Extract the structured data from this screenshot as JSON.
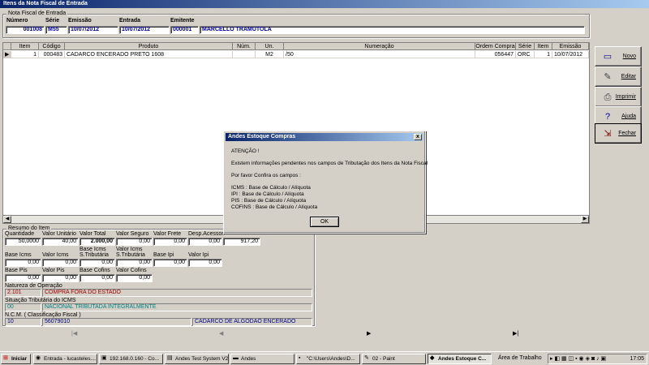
{
  "window": {
    "title": "Itens da Nota Fiscal de Entrada"
  },
  "header": {
    "group_title": "Nota Fiscal de Entrada",
    "labels": {
      "numero": "Número",
      "serie": "Série",
      "emissao": "Emissão",
      "entrada": "Entrada",
      "emitente": "Emitente"
    },
    "values": {
      "numero": "001008",
      "serie": "M55",
      "emissao": "10/07/2012",
      "entrada": "10/07/2012",
      "emitente_code": "000001",
      "emitente_name": "MARCELLO TRAMUTOLA"
    }
  },
  "grid": {
    "columns": [
      "Item",
      "Código",
      "Produto",
      "Núm.",
      "Un.",
      "Numeração",
      "Ordem Compra",
      "Série",
      "Item",
      "Emissão"
    ],
    "rows": [
      {
        "marker": "▶",
        "cells": [
          "1",
          "000483",
          "CADARCO ENCERADO PRETO 1608",
          "",
          "M2",
          "/50",
          "056447",
          "ORC",
          "1",
          "10/07/2012"
        ]
      }
    ]
  },
  "buttons": [
    {
      "label": "Novo",
      "icon": "new-document-icon",
      "glyph": "▭"
    },
    {
      "label": "Editar",
      "icon": "edit-pencil-icon",
      "glyph": "✎"
    },
    {
      "label": "Imprimir",
      "icon": "printer-icon",
      "glyph": "⎙"
    },
    {
      "label": "Ajuda",
      "icon": "help-icon",
      "glyph": "?"
    },
    {
      "label": "Fechar",
      "icon": "close-door-icon",
      "glyph": "⇲"
    }
  ],
  "summary": {
    "group_title": "Resumo do Item",
    "labels": {
      "quantidade": "Quantidade",
      "valor_unitario": "Valor Unitário",
      "valor_total": "Valor Total",
      "valor_seguro": "Valor Seguro",
      "valor_frete": "Valor Frete",
      "desp_acessor": "Desp.Acessor.",
      "base_icms": "Base Icms",
      "valor_icms": "Valor Icms",
      "base_icms_st": "Base Icms S.Tributária",
      "valor_icms_st": "Valor Icms S.Tributária",
      "base_ipi": "Base Ipi",
      "valor_ipi": "Valor Ipi",
      "base_pis": "Base Pis",
      "valor_pis": "Valor Pis",
      "base_cofins": "Base Cofins",
      "valor_cofins": "Valor Cofins",
      "natureza": "Natureza de Operação",
      "situacao": "Situação Tributária do ICMS",
      "ncm": "N.C.M. ( Classificação Fiscal )"
    },
    "values": {
      "quantidade": "50,0000",
      "valor_unitario": "40,00",
      "valor_total": "2.000,00",
      "valor_seguro": "0,00",
      "valor_frete": "0,00",
      "desp_acessor": "0,00",
      "extra_total": "917,20",
      "base_icms": "0,00",
      "valor_icms": "0,00",
      "base_icms_st": "0,00",
      "valor_icms_st": "0,00",
      "base_ipi": "0,00",
      "valor_ipi": "0,00",
      "base_pis": "0,00",
      "valor_pis": "0,00",
      "base_cofins": "0,00",
      "valor_cofins": "0,00",
      "natureza_code": "2.101",
      "natureza_desc": "COMPRA FORA DO ESTADO",
      "situacao_code": "00",
      "situacao_desc": "NACIONAL TRIBUTADA INTEGRALMENTE",
      "ncm_code": "10",
      "ncm_value": "56079010",
      "ncm_desc": "CADARCO DE ALGODAO ENCERADO"
    }
  },
  "navigator": {
    "first": "|◀",
    "prev": "◀",
    "next": "▶",
    "last": "▶|"
  },
  "dialog": {
    "title": "Andes Estoque Compras",
    "close": "x",
    "heading": "ATENÇÃO !",
    "line1": "Existem informações pendentes nos campos de Tributação dos Itens da Nota Fiscal",
    "line2": "Por favor Confira os campos :",
    "items": [
      "ICMS   : Base de Cálculo / Alíquota",
      "IPI    : Base de Cálculo / Alíquota",
      "PIS    : Base de Cálculo / Alíquota",
      "COFINS : Base de Cálculo / Alíquota"
    ],
    "ok": "OK"
  },
  "taskbar": {
    "start": "Iniciar",
    "tasks": [
      {
        "label": "Entrada - lucasteles....",
        "icon": "chrome-icon",
        "glyph": "◉"
      },
      {
        "label": "192.168.0.160 - Co...",
        "icon": "remote-desktop-icon",
        "glyph": "▣"
      },
      {
        "label": "Andes Test System V2",
        "icon": "app-window-icon",
        "glyph": "▤"
      },
      {
        "label": "Andes",
        "icon": "folder-icon",
        "glyph": "▬"
      },
      {
        "label": "\"C:\\Users\\Andes\\D...",
        "icon": "console-icon",
        "glyph": "▪"
      },
      {
        "label": "02 - Paint",
        "icon": "paint-icon",
        "glyph": "✎"
      },
      {
        "label": "Andes Estoque C...",
        "icon": "app-icon",
        "glyph": "◆"
      }
    ],
    "desktop_label": "Área de Trabalho",
    "clock": "17:05"
  }
}
